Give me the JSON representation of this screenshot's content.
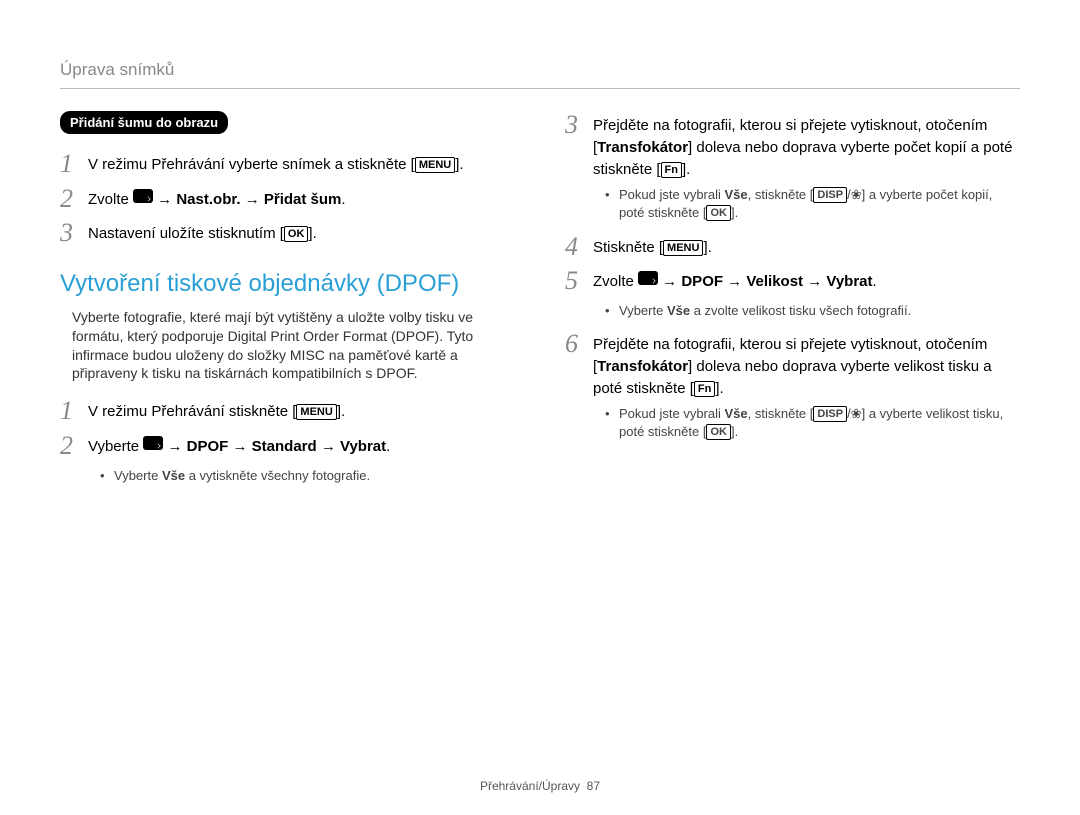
{
  "header": "Úprava snímků",
  "left": {
    "pill": "Přidání šumu do obrazu",
    "step1_pre": "V režimu Přehrávání vyberte snímek a stiskněte [",
    "step1_btn": "MENU",
    "step1_post": "].",
    "step2_pre": "Zvolte ",
    "step2_bold": " → Nast.obr. → Přidat šum",
    "step2_post": ".",
    "step3_pre": "Nastavení uložíte stisknutím [",
    "step3_btn": "OK",
    "step3_post": "].",
    "section_title": "Vytvoření tiskové objednávky (DPOF)",
    "section_intro": "Vyberte fotografie, které mají být vytištěny a uložte volby tisku ve formátu, který podporuje Digital Print Order Format (DPOF). Tyto infirmace budou uloženy do složky MISC na paměťové kartě a připraveny k tisku na tiskárnách kompatibilních s DPOF.",
    "d_step1_pre": "V režimu Přehrávání stiskněte [",
    "d_step1_btn": "MENU",
    "d_step1_post": "].",
    "d_step2_pre": "Vyberte ",
    "d_step2_bold": " → DPOF → Standard → Vybrat",
    "d_step2_post": ".",
    "d_bullet1_a": "Vyberte ",
    "d_bullet1_b": "Vše",
    "d_bullet1_c": " a vytiskněte všechny fotografie."
  },
  "right": {
    "step3_a": "Přejděte na fotografii, kterou si přejete vytisknout, otočením [",
    "step3_b": "Transfokátor",
    "step3_c": "] doleva nebo doprava vyberte počet kopií a poté stiskněte [",
    "step3_btn": "Fn",
    "step3_d": "].",
    "bullet3_a": "Pokud jste vybrali ",
    "bullet3_b": "Vše",
    "bullet3_c": ", stiskněte [",
    "bullet3_btn1": "DISP",
    "bullet3_d": "/",
    "bullet3_e": "] a vyberte počet kopií, poté stiskněte [",
    "bullet3_btn2": "OK",
    "bullet3_f": "].",
    "step4_a": "Stiskněte [",
    "step4_btn": "MENU",
    "step4_b": "].",
    "step5_pre": "Zvolte ",
    "step5_bold": " → DPOF → Velikost → Vybrat",
    "step5_post": ".",
    "bullet5_a": "Vyberte ",
    "bullet5_b": "Vše",
    "bullet5_c": " a zvolte velikost tisku všech fotografií.",
    "step6_a": "Přejděte na fotografii, kterou si přejete vytisknout, otočením [",
    "step6_b": "Transfokátor",
    "step6_c": "] doleva nebo doprava vyberte velikost tisku a poté stiskněte [",
    "step6_btn": "Fn",
    "step6_d": "].",
    "bullet6_a": "Pokud jste vybrali ",
    "bullet6_b": "Vše",
    "bullet6_c": ", stiskněte [",
    "bullet6_btn1": "DISP",
    "bullet6_d": "/",
    "bullet6_e": "] a vyberte velikost tisku, poté stiskněte [",
    "bullet6_btn2": "OK",
    "bullet6_f": "]."
  },
  "footer_text": "Přehrávání/Úpravy",
  "footer_page": "87"
}
